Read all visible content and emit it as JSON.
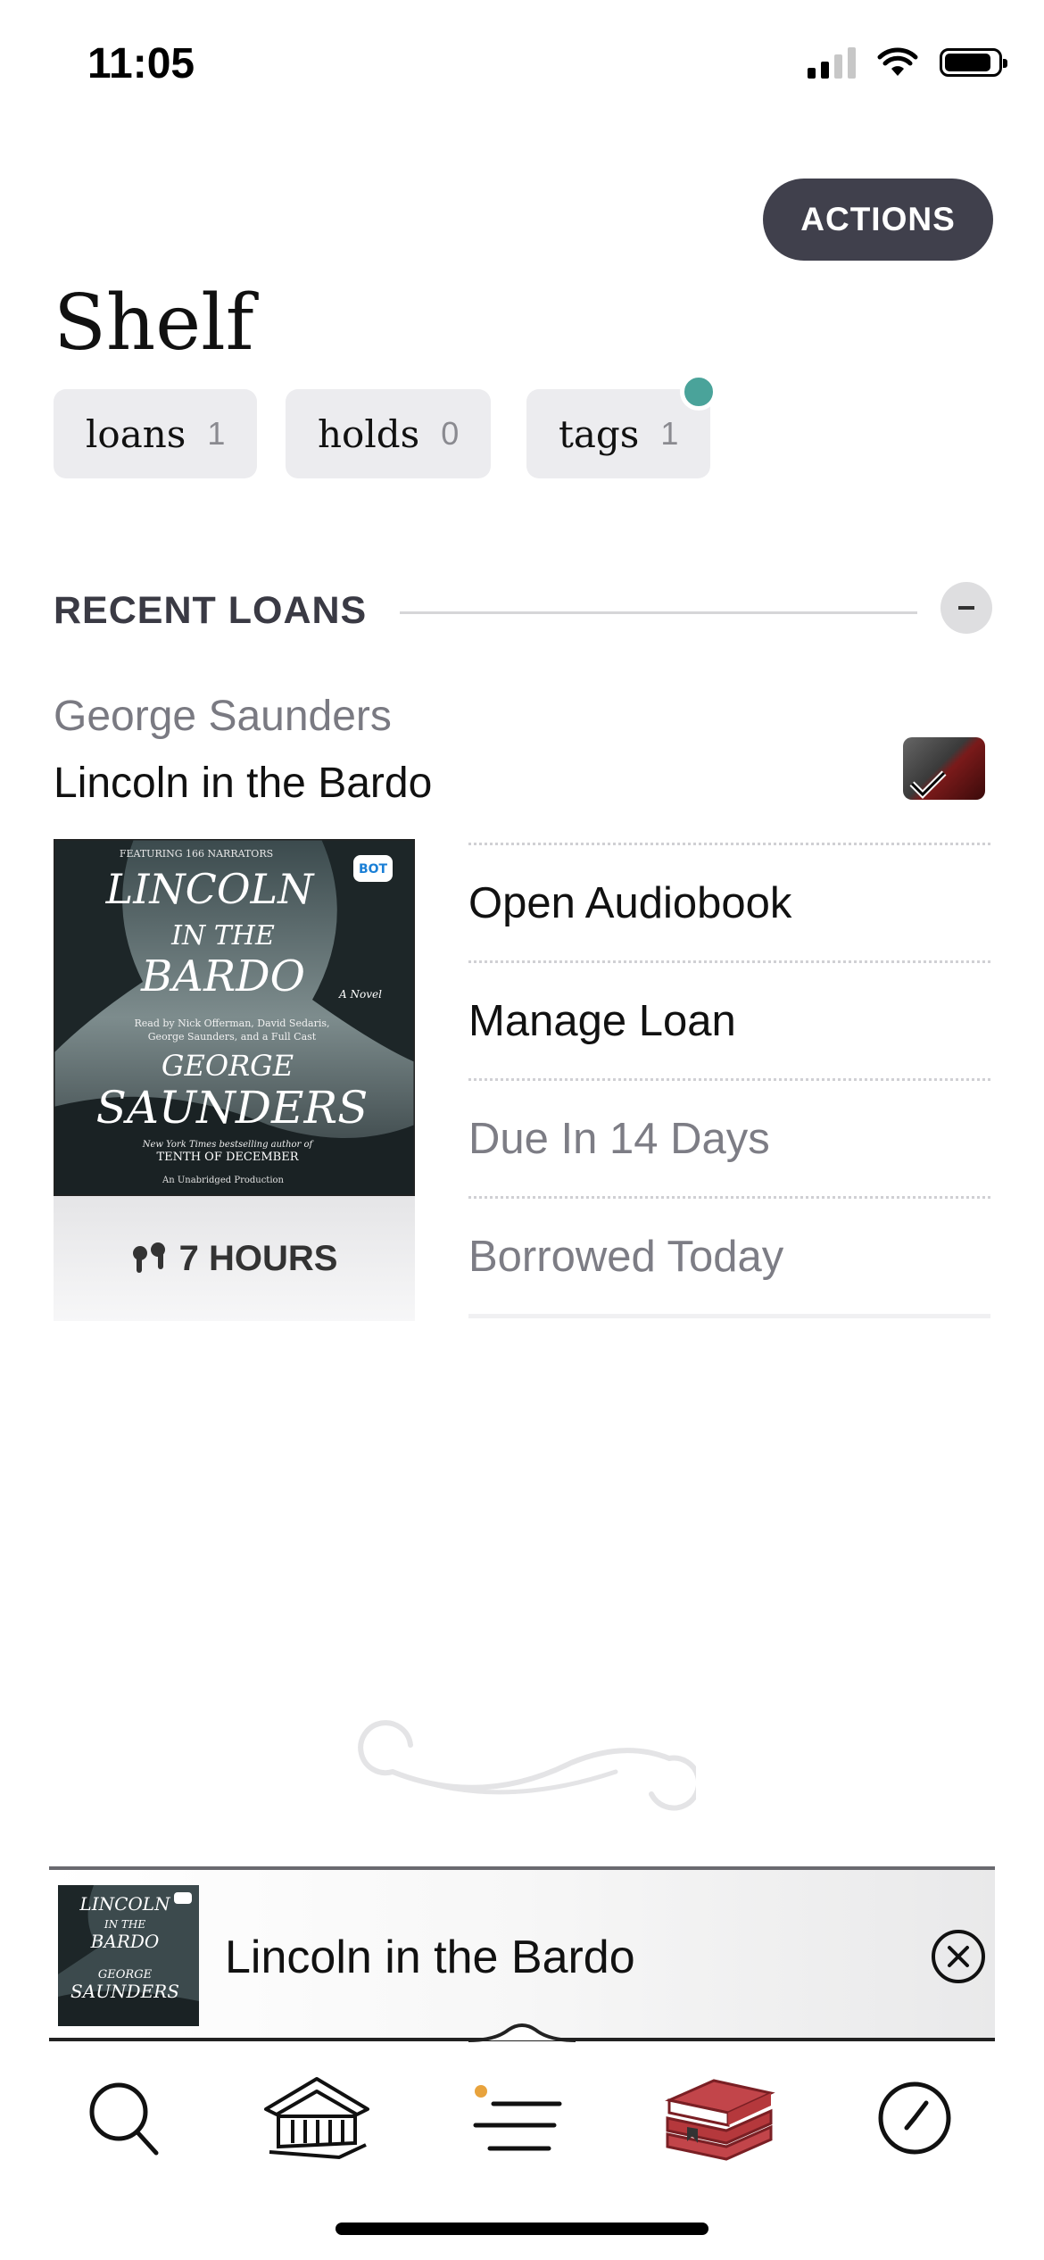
{
  "status_bar": {
    "time": "11:05"
  },
  "header": {
    "actions_label": "ACTIONS",
    "title": "Shelf"
  },
  "chips": [
    {
      "label": "loans",
      "count": "1"
    },
    {
      "label": "holds",
      "count": "0"
    },
    {
      "label": "tags",
      "count": "1"
    }
  ],
  "colors": {
    "accent_dot": "#4aa39a",
    "actions_bg": "#40404c",
    "shelf_icon": "#b5383c"
  },
  "recent": {
    "header": "RECENT LOANS",
    "author": "George Saunders",
    "title": "Lincoln in the Bardo",
    "cover": {
      "featuring": "FEATURING 166 NARRATORS",
      "title_lines": [
        "LINCOLN",
        "IN THE",
        "BARDO"
      ],
      "subtitle": "A Novel",
      "readby_lines": [
        "Read by Nick Offerman, David Sedaris,",
        "George Saunders, and a Full Cast"
      ],
      "author_lines": [
        "GEORGE",
        "SAUNDERS"
      ],
      "tagline": "New York Times bestselling author of",
      "prev_book": "TENTH OF DECEMBER",
      "edition": "An Unabridged Production",
      "badge": "BOT"
    },
    "duration": "7 HOURS",
    "menu": [
      "Open Audiobook",
      "Manage Loan",
      "Due In 14 Days",
      "Borrowed Today"
    ]
  },
  "now_playing": {
    "title": "Lincoln in the Bardo"
  },
  "tabs": [
    "search-icon",
    "library-icon",
    "menu-icon",
    "shelf-icon",
    "history-icon"
  ]
}
